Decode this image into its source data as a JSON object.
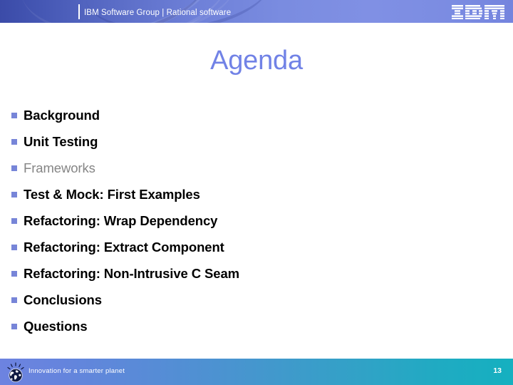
{
  "header": {
    "title": "IBM Software Group | Rational software",
    "logo_alt": "IBM"
  },
  "slide": {
    "title": "Agenda",
    "items": [
      {
        "label": "Background",
        "style": "bold"
      },
      {
        "label": "Unit Testing",
        "style": "bold"
      },
      {
        "label": "Frameworks",
        "style": "dim"
      },
      {
        "label": "Test & Mock: First Examples",
        "style": "bold"
      },
      {
        "label": "Refactoring: Wrap Dependency",
        "style": "bold"
      },
      {
        "label": "Refactoring: Extract Component",
        "style": "bold"
      },
      {
        "label": "Refactoring: Non-Intrusive C Seam",
        "style": "bold"
      },
      {
        "label": "Conclusions",
        "style": "bold"
      },
      {
        "label": "Questions",
        "style": "bold"
      }
    ]
  },
  "footer": {
    "tagline": "Innovation for a smarter planet",
    "page_number": "13"
  },
  "colors": {
    "title_blue": "#7182e6",
    "bullet_blue": "#7785d8",
    "dim_gray": "#858585",
    "header_blue_dark": "#3b4ba8",
    "header_blue_light": "#8090e4",
    "footer_cyan": "#15b0c0"
  }
}
